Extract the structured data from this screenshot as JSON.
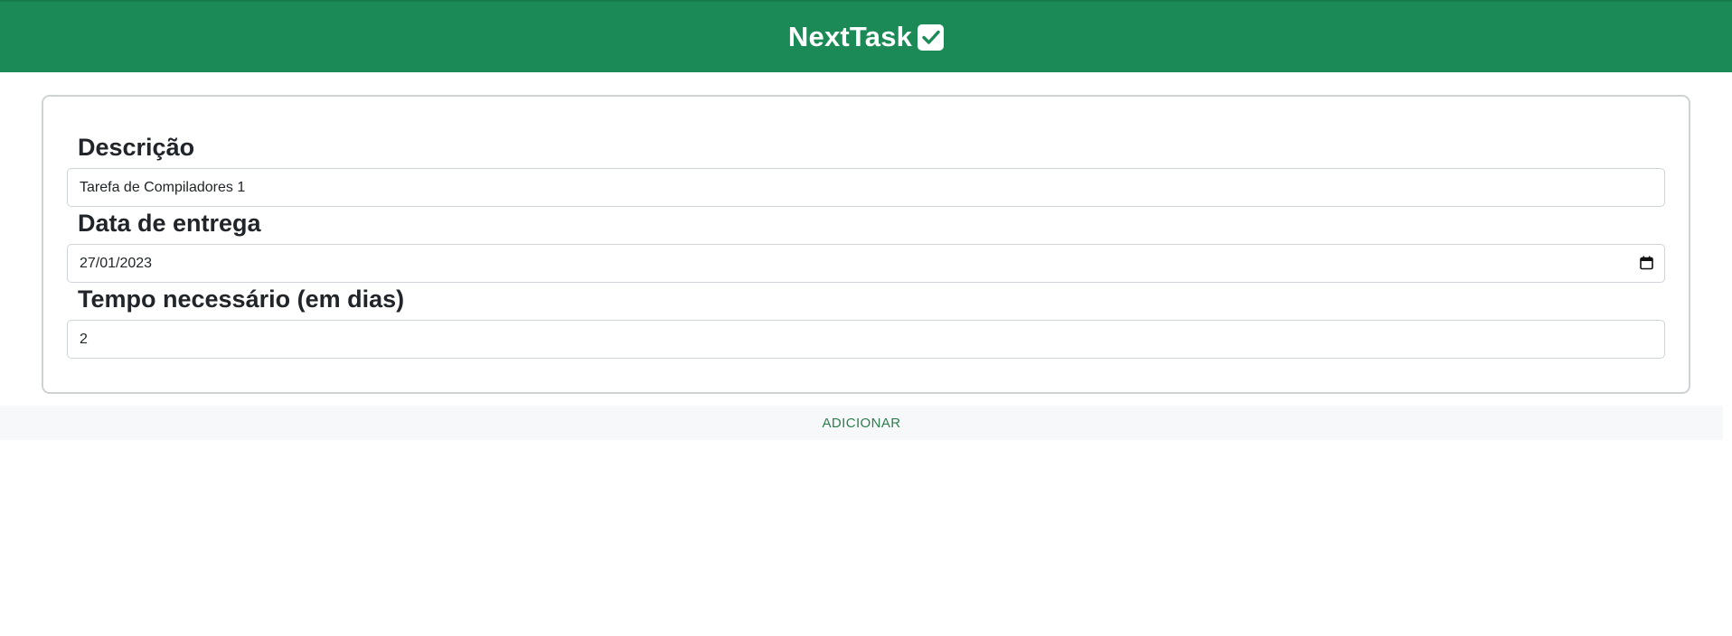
{
  "header": {
    "title": "NextTask",
    "icon": "check-square-icon",
    "background_color": "#1b8a56"
  },
  "form": {
    "description": {
      "label": "Descrição",
      "value": "Tarefa de Compiladores 1"
    },
    "due_date": {
      "label": "Data de entrega",
      "value": "27/01/2023",
      "icon": "calendar-icon"
    },
    "time_needed": {
      "label": "Tempo necessário (em dias)",
      "value": "2"
    }
  },
  "actions": {
    "add_label": "ADICIONAR",
    "accent_color": "#2e7d4f"
  }
}
